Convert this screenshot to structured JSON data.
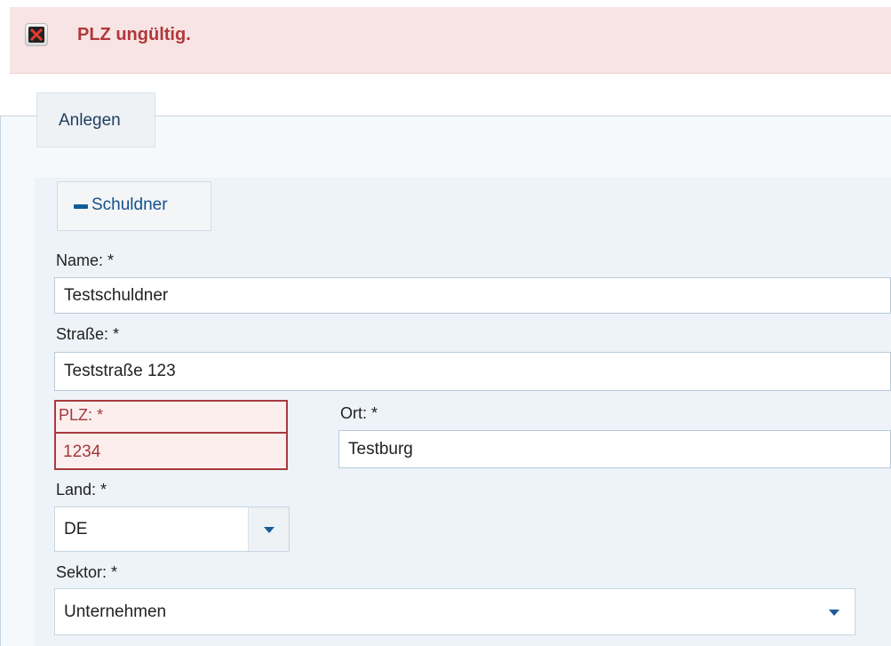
{
  "error": {
    "message": "PLZ ungültig."
  },
  "fieldset": {
    "legend": "Anlegen"
  },
  "section": {
    "toggle_icon": "minus-icon",
    "title": "Schuldner"
  },
  "form": {
    "name": {
      "label": "Name: *",
      "value": "Testschuldner"
    },
    "street": {
      "label": "Straße: *",
      "value": "Teststraße 123"
    },
    "plz": {
      "label": "PLZ: *",
      "value": "1234",
      "state": "error"
    },
    "city": {
      "label": "Ort: *",
      "value": "Testburg"
    },
    "country": {
      "label": "Land: *",
      "selected": "DE"
    },
    "sector": {
      "label": "Sektor: *",
      "selected": "Unternehmen"
    }
  },
  "colors": {
    "error_text": "#b0383b",
    "error_background": "#f8e4e4",
    "accent": "#16518a"
  }
}
